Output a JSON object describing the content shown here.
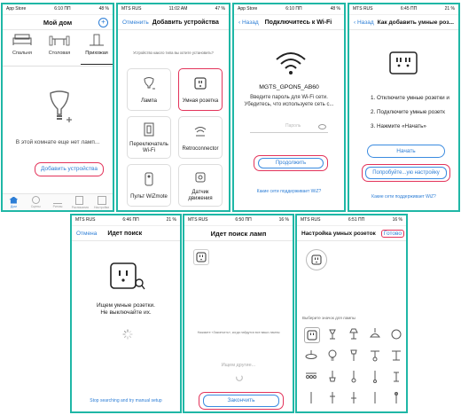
{
  "screen1": {
    "status": {
      "left": "App Store",
      "time": "6:10 ПП",
      "right": "48 %"
    },
    "title": "Мой дом",
    "rooms": [
      "Спальня",
      "Столовая",
      "Прихожая"
    ],
    "empty_text": "В этой комнате еще нет ламп...",
    "add_button": "Добавить устройства",
    "tabs": [
      "Дом",
      "Сцены",
      "Ритмы",
      "Расписания",
      "Настройки"
    ]
  },
  "screen2": {
    "status": {
      "left": "MTS RUS",
      "time": "11:02 AM",
      "right": "47 %"
    },
    "cancel": "Отменить",
    "title": "Добавить устройства",
    "question": "Устройство какого типа вы хотите установить?",
    "devices": [
      "Лампа",
      "Умная розетка",
      "Переключатель Wi-Fi",
      "Retroconnector",
      "Пульт WiZmote",
      "Датчик движения"
    ]
  },
  "screen3": {
    "status": {
      "left": "App Store",
      "time": "6:10 ПП",
      "right": "48 %"
    },
    "back": "Назад",
    "title": "Подключитесь к Wi-Fi",
    "ssid": "MGTS_GPON5_AB60",
    "instruction": "Введите пароль для Wi-Fi сети. Убедитесь, что используете сеть с...",
    "password_placeholder": "Пароль",
    "continue": "Продолжить",
    "supported_link": "Какие сети поддерживает WiZ?"
  },
  "screen4": {
    "status": {
      "left": "MTS RUS",
      "time": "6:45 ПП",
      "right": "21 %"
    },
    "back": "Назад",
    "title": "Как добавить умные роз...",
    "steps": [
      "1. Отключите умные розетки и",
      "2. Подключите умные розетк",
      "3. Нажмите «Начать»"
    ],
    "start": "Начать",
    "try_manual": "Попробуйте...ую настройку",
    "supported_link": "Какие сети поддерживает WiZ?"
  },
  "screen5": {
    "status": {
      "left": "MTS RUS",
      "time": "6:46 ПП",
      "right": "21 %"
    },
    "cancel": "Отмена",
    "title": "Идет поиск",
    "message": "Ищем умные розетки.\nНе выключайте их.",
    "bottom_link": "Stop searching and try manual setup"
  },
  "screen6": {
    "status": {
      "left": "MTS RUS",
      "time": "6:50 ПП",
      "right": "16 %"
    },
    "title": "Идет поиск ламп",
    "hint": "Нажмите «Закончить», когда найдутся все ваши лампы",
    "searching": "Ищем другие...",
    "finish": "Закончить"
  },
  "screen7": {
    "status": {
      "left": "MTS RUS",
      "time": "6:51 ПП",
      "right": "16 %"
    },
    "title": "Настройка умных розеток",
    "done": "Готово",
    "choose_icon": "Выберите значок для лампы"
  },
  "colors": {
    "frame": "#1fb7a6",
    "highlight": "#e3335a",
    "link": "#2d7ed6"
  }
}
